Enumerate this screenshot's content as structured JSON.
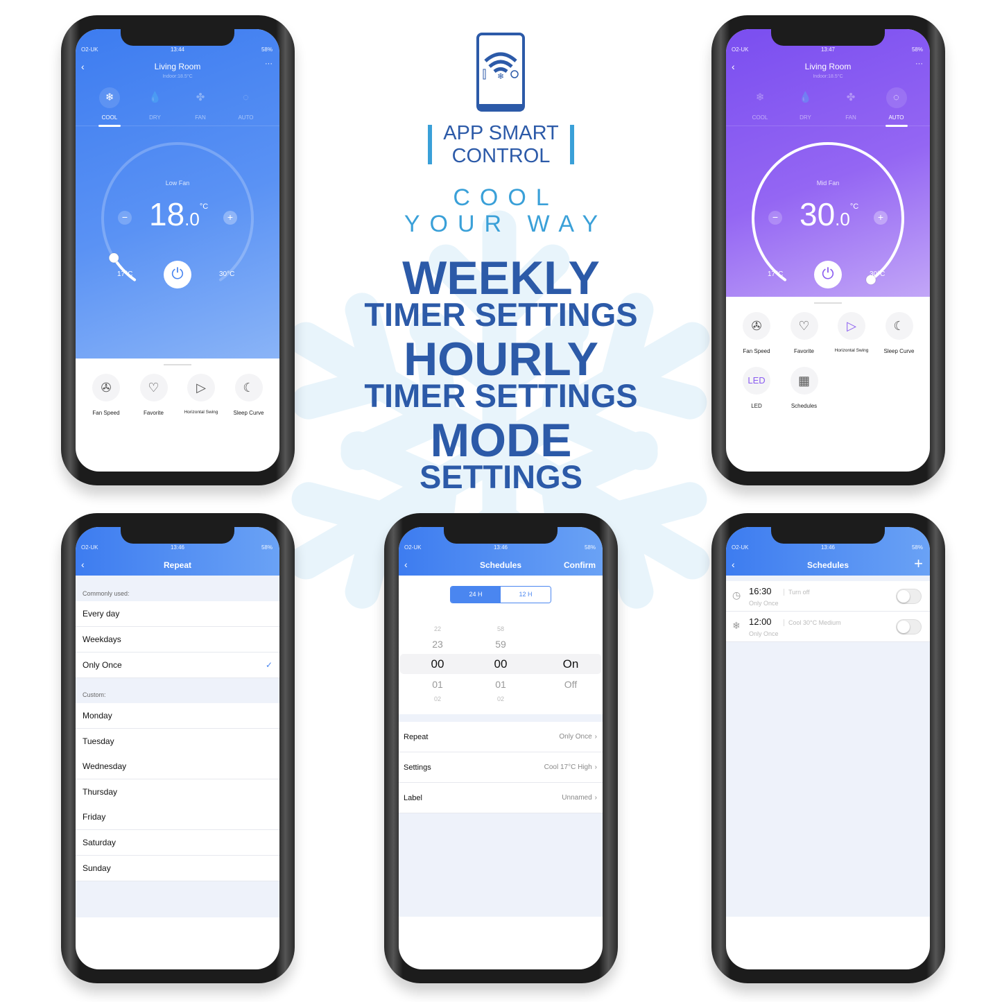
{
  "colors": {
    "brand_blue": "#2c5aa8",
    "accent_light_blue": "#3aa0d8",
    "phone_blue": "#4a86f0",
    "phone_purple": "#8a5cf0"
  },
  "center": {
    "logo_icons": [
      "smartphone-icon",
      "wifi-icon",
      "thermometer-icon",
      "snowflake-icon",
      "timer-icon"
    ],
    "app_title_line1": "APP SMART",
    "app_title_line2": "CONTROL",
    "tagline1": "COOL",
    "tagline2": "YOUR WAY",
    "h1": "WEEKLY",
    "h1_sub": "TIMER SETTINGS",
    "h2": "HOURLY",
    "h2_sub": "TIMER SETTINGS",
    "h3": "MODE",
    "h3_sub": "SETTINGS"
  },
  "phone_cool": {
    "status": {
      "carrier": "O2-UK",
      "time": "13:44",
      "battery": "58%"
    },
    "title": "Living Room",
    "subtitle": "Indoor:18.5°C",
    "more": "···",
    "modes": [
      {
        "label": "COOL",
        "icon": "❄",
        "active": true
      },
      {
        "label": "DRY",
        "icon": "💧",
        "active": false
      },
      {
        "label": "FAN",
        "icon": "✤",
        "active": false
      },
      {
        "label": "AUTO",
        "icon": "◌",
        "active": false
      }
    ],
    "fan_label": "Low Fan",
    "temp": "18",
    "temp_dec": ".0",
    "unit": "°C",
    "min": "17°C",
    "max": "30°C",
    "setpoint_fraction": 0.08,
    "functions": [
      {
        "label": "Fan Speed",
        "icon": "✇"
      },
      {
        "label": "Favorite",
        "icon": "♡"
      },
      {
        "label": "Horizontal Swing",
        "icon": "▷"
      },
      {
        "label": "Sleep Curve",
        "icon": "☾"
      }
    ]
  },
  "phone_auto": {
    "status": {
      "carrier": "O2-UK",
      "time": "13:47",
      "battery": "58%"
    },
    "title": "Living Room",
    "subtitle": "Indoor:18.5°C",
    "more": "···",
    "modes": [
      {
        "label": "COOL",
        "icon": "❄",
        "active": false
      },
      {
        "label": "DRY",
        "icon": "💧",
        "active": false
      },
      {
        "label": "FAN",
        "icon": "✤",
        "active": false
      },
      {
        "label": "AUTO",
        "icon": "◌",
        "active": true
      }
    ],
    "fan_label": "Mid Fan",
    "temp": "30",
    "temp_dec": ".0",
    "unit": "°C",
    "min": "17°C",
    "max": "30°C",
    "setpoint_fraction": 1.0,
    "functions": [
      {
        "label": "Fan Speed",
        "icon": "✇"
      },
      {
        "label": "Favorite",
        "icon": "♡"
      },
      {
        "label": "Horizontal Swing",
        "icon": "▷"
      },
      {
        "label": "Sleep Curve",
        "icon": "☾"
      },
      {
        "label": "LED",
        "icon": "LED"
      },
      {
        "label": "Schedules",
        "icon": "▦"
      }
    ]
  },
  "phone_repeat": {
    "status": {
      "carrier": "O2-UK",
      "time": "13:46",
      "battery": "58%"
    },
    "title": "Repeat",
    "common_header": "Commonly used:",
    "common": [
      {
        "label": "Every day",
        "checked": false
      },
      {
        "label": "Weekdays",
        "checked": false
      },
      {
        "label": "Only Once",
        "checked": true
      }
    ],
    "custom_header": "Custom:",
    "custom": [
      "Monday",
      "Tuesday",
      "Wednesday",
      "Thursday",
      "Friday",
      "Saturday",
      "Sunday"
    ]
  },
  "phone_timer": {
    "status": {
      "carrier": "O2-UK",
      "time": "13:46",
      "battery": "58%"
    },
    "title": "Schedules",
    "confirm": "Confirm",
    "formats": [
      {
        "label": "24 H",
        "active": true
      },
      {
        "label": "12 H",
        "active": false
      }
    ],
    "hours": [
      "22",
      "23",
      "00",
      "01",
      "02"
    ],
    "minutes": [
      "58",
      "59",
      "00",
      "01",
      "02"
    ],
    "states": [
      "",
      "",
      "On",
      "Off",
      ""
    ],
    "settings": [
      {
        "label": "Repeat",
        "value": "Only Once"
      },
      {
        "label": "Settings",
        "value": "Cool 17°C High"
      },
      {
        "label": "Label",
        "value": "Unnamed"
      }
    ]
  },
  "phone_schedules": {
    "status": {
      "carrier": "O2-UK",
      "time": "13:46",
      "battery": "58%"
    },
    "title": "Schedules",
    "add": "+",
    "items": [
      {
        "time": "16:30",
        "action": "Turn off",
        "repeat": "Only Once",
        "icon": "timer-off-icon",
        "enabled": false
      },
      {
        "time": "12:00",
        "action": "Cool 30°C Medium",
        "repeat": "Only Once",
        "icon": "snowflake-icon",
        "enabled": false
      }
    ]
  }
}
